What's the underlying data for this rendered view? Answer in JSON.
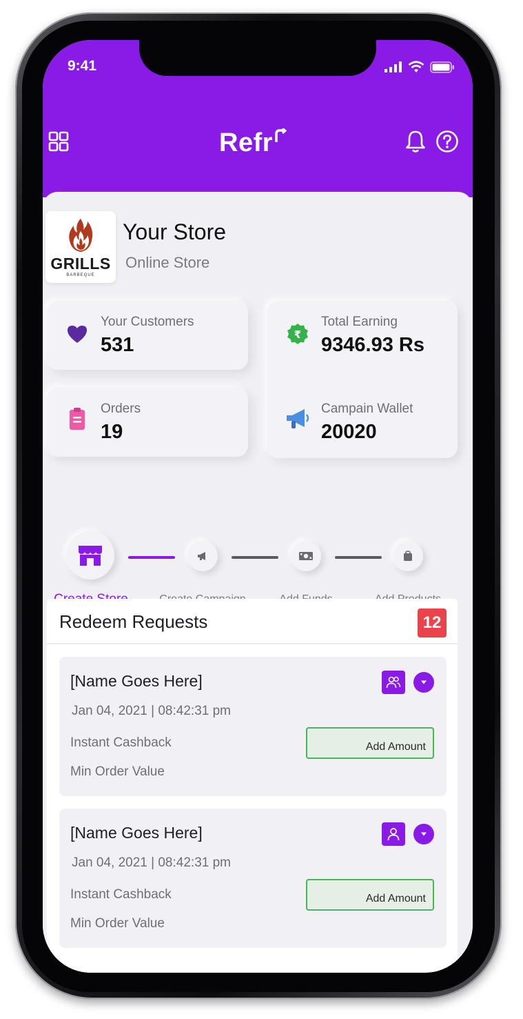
{
  "status_bar": {
    "time": "9:41"
  },
  "header": {
    "brand": "Refr",
    "icons": [
      "grid-icon",
      "bell-icon",
      "help-icon"
    ],
    "accent_color": "#8a1be6"
  },
  "store": {
    "logo_text": "GRILLS",
    "logo_subtext": "BARBEQUE",
    "name": "Your Store",
    "type": "Online Store"
  },
  "stats": [
    {
      "label": "Your Customers",
      "value": "531",
      "icon": "heart-icon"
    },
    {
      "label": "Orders",
      "value": "19",
      "icon": "clipboard-icon"
    },
    {
      "label": "Total Earning",
      "value": "9346.93 Rs",
      "icon": "rupee-badge-icon"
    },
    {
      "label": "Campain Wallet",
      "value": "20020",
      "icon": "megaphone-icon"
    }
  ],
  "steps": [
    {
      "label": "Create Store",
      "icon": "store-icon",
      "active": true
    },
    {
      "label": "Create Campaign",
      "icon": "megaphone-icon",
      "active": false
    },
    {
      "label": "Add Funds",
      "icon": "cash-icon",
      "active": false
    },
    {
      "label": "Add Products",
      "icon": "bag-icon",
      "active": false
    }
  ],
  "redeem": {
    "title": "Redeem Requests",
    "count": "12",
    "requests": [
      {
        "name": "[Name Goes Here]",
        "datetime": "Jan 04, 2021 | 08:42:31 pm",
        "line1": "Instant Cashback",
        "line2": "Min Order Value",
        "button": "Add Amount",
        "user_icon": "users-icon"
      },
      {
        "name": "[Name Goes Here]",
        "datetime": "Jan 04, 2021 | 08:42:31 pm",
        "line1": "Instant Cashback",
        "line2": "Min Order Value",
        "button": "Add Amount",
        "user_icon": "user-icon"
      }
    ]
  }
}
